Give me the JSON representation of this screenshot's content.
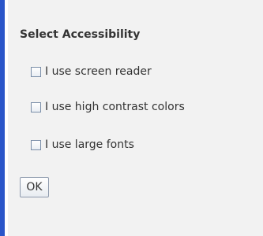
{
  "dialog": {
    "title": "Select Accessibility",
    "options": [
      {
        "label": "I use screen reader",
        "checked": false
      },
      {
        "label": "I use high contrast colors",
        "checked": false
      },
      {
        "label": "I use large fonts",
        "checked": false
      }
    ],
    "ok_label": "OK"
  },
  "colors": {
    "accent_border": "#2a55c9",
    "panel_background": "#f2f2f2",
    "text": "#333333"
  }
}
